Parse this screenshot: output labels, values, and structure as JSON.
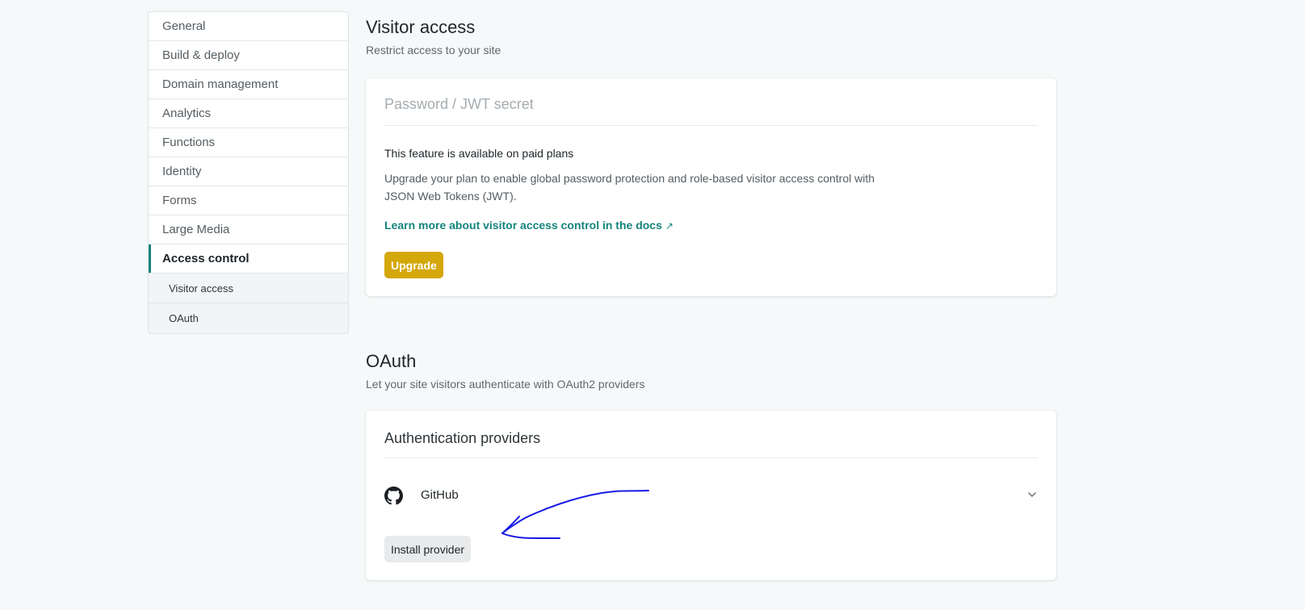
{
  "sidebar": {
    "items": [
      {
        "label": "General"
      },
      {
        "label": "Build & deploy"
      },
      {
        "label": "Domain management"
      },
      {
        "label": "Analytics"
      },
      {
        "label": "Functions"
      },
      {
        "label": "Identity"
      },
      {
        "label": "Forms"
      },
      {
        "label": "Large Media"
      },
      {
        "label": "Access control"
      }
    ],
    "active_item": "Access control",
    "subitems": [
      {
        "label": "Visitor access"
      },
      {
        "label": "OAuth"
      }
    ]
  },
  "visitor_access": {
    "title": "Visitor access",
    "subtitle": "Restrict access to your site",
    "password_placeholder": "Password / JWT secret",
    "feature_title": "This feature is available on paid plans",
    "feature_desc": "Upgrade your plan to enable global password protection and role-based visitor access control with JSON Web Tokens (JWT).",
    "docs_link": "Learn more about visitor access control in the docs",
    "docs_link_icon": "↗",
    "upgrade_label": "Upgrade"
  },
  "oauth": {
    "title": "OAuth",
    "subtitle": "Let your site visitors authenticate with OAuth2 providers",
    "card_title": "Authentication providers",
    "provider_name": "GitHub",
    "provider_icon": "github-icon",
    "install_label": "Install provider"
  },
  "colors": {
    "accent": "#15847d",
    "upgrade": "#d4a70a",
    "annotation": "#1a1ae6"
  }
}
